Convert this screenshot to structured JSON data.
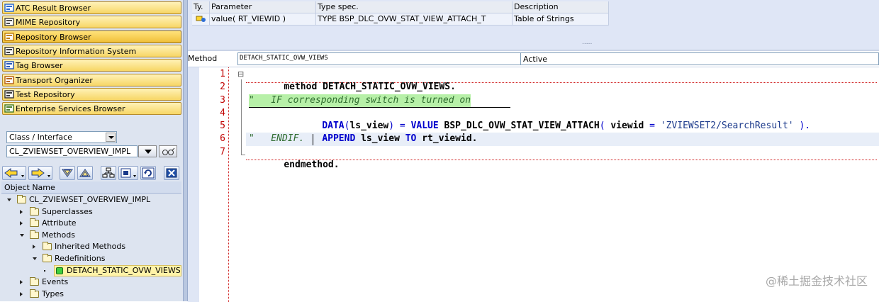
{
  "nav": {
    "buttons": [
      {
        "label": "ATC Result Browser",
        "icon": "atc-icon",
        "active": false
      },
      {
        "label": "MIME Repository",
        "icon": "mime-icon",
        "active": false
      },
      {
        "label": "Repository Browser",
        "icon": "repository-icon",
        "active": true
      },
      {
        "label": "Repository Information System",
        "icon": "info-system-icon",
        "active": false
      },
      {
        "label": "Tag Browser",
        "icon": "tag-icon",
        "active": false
      },
      {
        "label": "Transport Organizer",
        "icon": "transport-icon",
        "active": false
      },
      {
        "label": "Test Repository",
        "icon": "test-icon",
        "active": false
      },
      {
        "label": "Enterprise Services Browser",
        "icon": "enterprise-services-icon",
        "active": false
      }
    ]
  },
  "object_selector": {
    "type_value": "Class / Interface",
    "name_value": "CL_ZVIEWSET_OVERVIEW_IMPL"
  },
  "tree": {
    "header": "Object Name",
    "items": [
      {
        "label": "CL_ZVIEWSET_OVERVIEW_IMPL",
        "level": 0,
        "expanded": true,
        "kind": "folder-open"
      },
      {
        "label": "Superclasses",
        "level": 1,
        "expanded": false,
        "kind": "folder"
      },
      {
        "label": "Attribute",
        "level": 1,
        "expanded": false,
        "kind": "folder"
      },
      {
        "label": "Methods",
        "level": 1,
        "expanded": true,
        "kind": "folder-open"
      },
      {
        "label": "Inherited Methods",
        "level": 2,
        "expanded": false,
        "kind": "folder"
      },
      {
        "label": "Redefinitions",
        "level": 2,
        "expanded": true,
        "kind": "folder-open"
      },
      {
        "label": "DETACH_STATIC_OVW_VIEWS",
        "level": 3,
        "expanded": false,
        "kind": "method",
        "selected": true
      },
      {
        "label": "Events",
        "level": 1,
        "expanded": false,
        "kind": "folder"
      },
      {
        "label": "Types",
        "level": 1,
        "expanded": false,
        "kind": "folder"
      }
    ]
  },
  "params": {
    "headers": [
      "Ty.",
      "Parameter",
      "Type spec.",
      "Description"
    ],
    "rows": [
      {
        "type_icon": "returning-param-icon",
        "parameter": "value( RT_VIEWID )",
        "type_spec": "TYPE BSP_DLC_OVW_STAT_VIEW_ATTACH_T",
        "description": "Table of Strings"
      }
    ],
    "resize_handle": "....."
  },
  "method": {
    "label": "Method",
    "name": "DETACH_STATIC_OVW_VIEWS",
    "status": "Active"
  },
  "editor": {
    "line_numbers": [
      "1",
      "2",
      "3",
      "4",
      "5",
      "6",
      "7"
    ],
    "fold_icon": "⊟",
    "line1": {
      "kw": "method",
      "name": "DETACH_STATIC_OVW_VIEWS",
      "dot": "."
    },
    "line3": {
      "comment": "\"   IF corresponding switch is turned on"
    },
    "line4": {
      "kw_data": "DATA",
      "p1": "(",
      "var": "ls_view",
      "p2": ")",
      "eq": "=",
      "kw_value": "VALUE",
      "type": "BSP_DLC_OVW_STAT_VIEW_ATTACH",
      "p3": "(",
      "field": "viewid",
      "eq2": "=",
      "literal": "'ZVIEWSET2/SearchResult'",
      "p4": ").",
      "end": "."
    },
    "line5": {
      "kw_append": "APPEND",
      "var": "ls_view",
      "kw_to": "TO",
      "target": "rt_viewid",
      "dot": "."
    },
    "line6": {
      "comment": "\"   ENDIF."
    },
    "line7": {
      "kw": "endmethod",
      "dot": "."
    }
  },
  "watermark": "@稀土掘金技术社区",
  "colors": {
    "nav_button": "#f7d665",
    "pane_bg": "#dde4f0",
    "comment_bg": "#b7f0a8",
    "line_number": "#c00000",
    "keyword": "#0000cc"
  }
}
